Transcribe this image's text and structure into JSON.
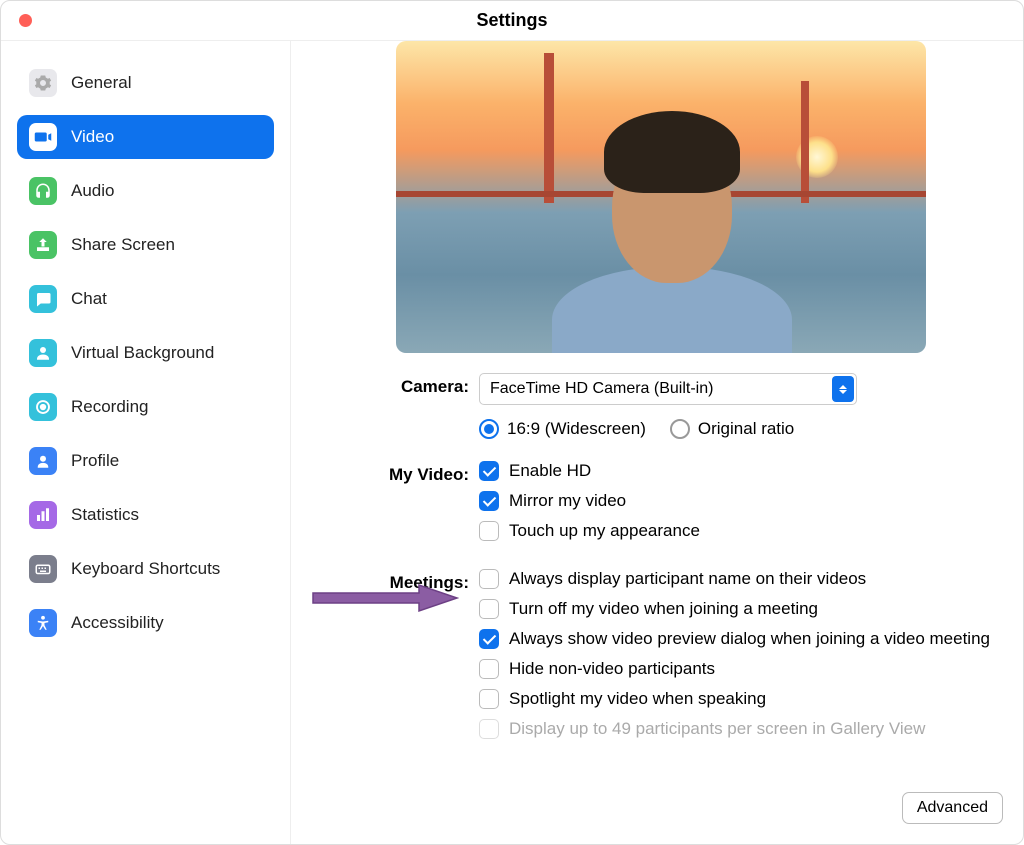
{
  "title": "Settings",
  "sidebar": {
    "items": [
      {
        "label": "General",
        "icon": "gear-icon",
        "bg": "#e8e8ec",
        "svg": "gear"
      },
      {
        "label": "Video",
        "icon": "video-icon",
        "bg": "#ffffff",
        "svg": "video",
        "active": true
      },
      {
        "label": "Audio",
        "icon": "audio-icon",
        "bg": "#4ac365",
        "svg": "headphones"
      },
      {
        "label": "Share Screen",
        "icon": "share-icon",
        "bg": "#4ac365",
        "svg": "share"
      },
      {
        "label": "Chat",
        "icon": "chat-icon",
        "bg": "#34c1db",
        "svg": "chat"
      },
      {
        "label": "Virtual Background",
        "icon": "virtual-bg-icon",
        "bg": "#34c1db",
        "svg": "person"
      },
      {
        "label": "Recording",
        "icon": "recording-icon",
        "bg": "#34c1db",
        "svg": "record"
      },
      {
        "label": "Profile",
        "icon": "profile-icon",
        "bg": "#3b82f6",
        "svg": "profile"
      },
      {
        "label": "Statistics",
        "icon": "statistics-icon",
        "bg": "#a569e6",
        "svg": "stats"
      },
      {
        "label": "Keyboard Shortcuts",
        "icon": "keyboard-icon",
        "bg": "#7b7e8c",
        "svg": "keyboard"
      },
      {
        "label": "Accessibility",
        "icon": "accessibility-icon",
        "bg": "#3b82f6",
        "svg": "accessibility"
      }
    ]
  },
  "form": {
    "camera_label": "Camera:",
    "camera_value": "FaceTime HD Camera (Built-in)",
    "ratio": {
      "widescreen": "16:9 (Widescreen)",
      "original": "Original ratio",
      "selected": "widescreen"
    },
    "myvideo_label": "My Video:",
    "myvideo": [
      {
        "label": "Enable HD",
        "checked": true
      },
      {
        "label": "Mirror my video",
        "checked": true
      },
      {
        "label": "Touch up my appearance",
        "checked": false
      }
    ],
    "meetings_label": "Meetings:",
    "meetings": [
      {
        "label": "Always display participant name on their videos",
        "checked": false
      },
      {
        "label": "Turn off my video when joining a meeting",
        "checked": false
      },
      {
        "label": "Always show video preview dialog when joining a video meeting",
        "checked": true
      },
      {
        "label": "Hide non-video participants",
        "checked": false
      },
      {
        "label": "Spotlight my video when speaking",
        "checked": false
      },
      {
        "label": "Display up to 49 participants per screen in Gallery View",
        "checked": false,
        "disabled": true
      }
    ],
    "advanced": "Advanced"
  }
}
